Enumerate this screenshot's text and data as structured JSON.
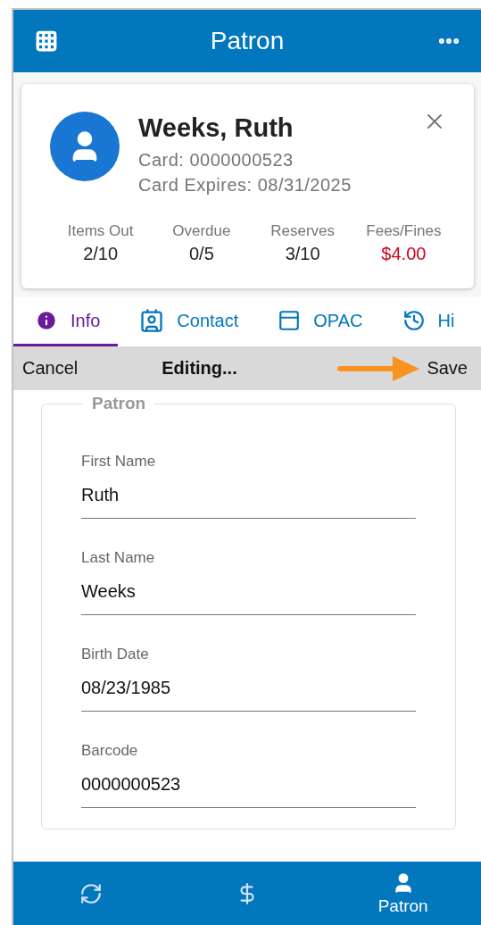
{
  "header": {
    "title": "Patron"
  },
  "patron": {
    "name": "Weeks, Ruth",
    "card": "Card: 0000000523",
    "expires": "Card Expires: 08/31/2025",
    "stats": [
      {
        "label": "Items Out",
        "value": "2/10",
        "alert": false
      },
      {
        "label": "Overdue",
        "value": "0/5",
        "alert": false
      },
      {
        "label": "Reserves",
        "value": "3/10",
        "alert": false
      },
      {
        "label": "Fees/Fines",
        "value": "$4.00",
        "alert": true
      }
    ]
  },
  "tabs": [
    {
      "kind": "info",
      "label": "Info",
      "selected": true
    },
    {
      "kind": "contact",
      "label": "Contact",
      "selected": false
    },
    {
      "kind": "opac",
      "label": "OPAC",
      "selected": false
    },
    {
      "kind": "history",
      "label": "Hi",
      "selected": false
    }
  ],
  "edit_bar": {
    "cancel": "Cancel",
    "status": "Editing...",
    "save": "Save"
  },
  "form": {
    "legend": "Patron",
    "fields": [
      {
        "label": "First Name",
        "value": "Ruth"
      },
      {
        "label": "Last Name",
        "value": "Weeks"
      },
      {
        "label": "Birth Date",
        "value": "08/23/1985"
      },
      {
        "label": "Barcode",
        "value": "0000000523"
      }
    ]
  },
  "bottom_nav": [
    {
      "kind": "renew",
      "selected": false
    },
    {
      "kind": "fees",
      "selected": false
    },
    {
      "kind": "patron",
      "label": "Patron",
      "selected": true
    }
  ]
}
